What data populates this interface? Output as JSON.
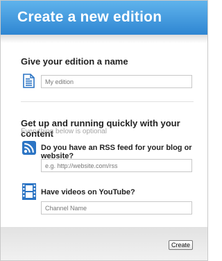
{
  "header": {
    "title": "Create a new edition"
  },
  "name_section": {
    "title": "Give your edition a name",
    "input_placeholder": "My edition",
    "icon": "document-icon"
  },
  "content_section": {
    "title": "Get up and running quickly with your content",
    "subtitle": "Everything below is optional",
    "rss": {
      "label": "Do you have an RSS feed for your blog or website?",
      "placeholder": "e.g. http://website.com/rss",
      "icon": "rss-feed-icon"
    },
    "youtube": {
      "label": "Have videos on YouTube?",
      "placeholder": "Channel Name",
      "icon": "film-strip-icon"
    }
  },
  "footer": {
    "create_label": "Create"
  },
  "colors": {
    "header_top": "#5fb3ec",
    "header_bottom": "#2f86d2",
    "icon_blue": "#2b74c4"
  }
}
